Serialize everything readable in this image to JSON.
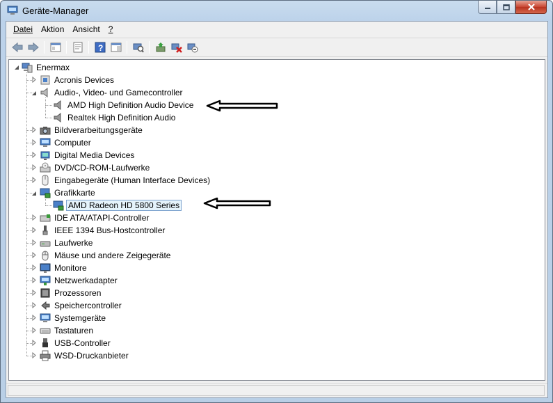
{
  "window": {
    "title": "Geräte-Manager"
  },
  "menu": [
    {
      "label": "Datei"
    },
    {
      "label": "Aktion"
    },
    {
      "label": "Ansicht"
    },
    {
      "label": "?"
    }
  ],
  "toolbar": {
    "buttons": [
      "back-icon",
      "forward-icon",
      "show-hide-console-tree-icon",
      "properties-icon",
      "help-icon",
      "action-pane-icon",
      "scan-hardware-icon",
      "update-driver-icon",
      "uninstall-icon",
      "disable-icon"
    ]
  },
  "tree": {
    "root": "Enermax",
    "categories": [
      {
        "label": "Acronis Devices",
        "icon": "acronis-icon",
        "expanded": false
      },
      {
        "label": "Audio-, Video- und Gamecontroller",
        "icon": "speaker-icon",
        "expanded": true,
        "children": [
          "AMD High Definition Audio Device",
          "Realtek High Definition Audio"
        ]
      },
      {
        "label": "Bildverarbeitungsgeräte",
        "icon": "camera-icon",
        "expanded": false
      },
      {
        "label": "Computer",
        "icon": "computer-icon",
        "expanded": false
      },
      {
        "label": "Digital Media Devices",
        "icon": "media-device-icon",
        "expanded": false
      },
      {
        "label": "DVD/CD-ROM-Laufwerke",
        "icon": "dvd-drive-icon",
        "expanded": false
      },
      {
        "label": "Eingabegeräte (Human Interface Devices)",
        "icon": "hid-icon",
        "expanded": false
      },
      {
        "label": "Grafikkarte",
        "icon": "display-adapter-icon",
        "expanded": true,
        "children": [
          "AMD Radeon HD 5800 Series"
        ]
      },
      {
        "label": "IDE ATA/ATAPI-Controller",
        "icon": "ide-controller-icon",
        "expanded": false
      },
      {
        "label": "IEEE 1394 Bus-Hostcontroller",
        "icon": "firewire-icon",
        "expanded": false
      },
      {
        "label": "Laufwerke",
        "icon": "disk-drive-icon",
        "expanded": false
      },
      {
        "label": "Mäuse und andere Zeigegeräte",
        "icon": "mouse-icon",
        "expanded": false
      },
      {
        "label": "Monitore",
        "icon": "monitor-icon",
        "expanded": false
      },
      {
        "label": "Netzwerkadapter",
        "icon": "network-adapter-icon",
        "expanded": false
      },
      {
        "label": "Prozessoren",
        "icon": "processor-icon",
        "expanded": false
      },
      {
        "label": "Speichercontroller",
        "icon": "storage-controller-icon",
        "expanded": false
      },
      {
        "label": "Systemgeräte",
        "icon": "system-devices-icon",
        "expanded": false
      },
      {
        "label": "Tastaturen",
        "icon": "keyboard-icon",
        "expanded": false
      },
      {
        "label": "USB-Controller",
        "icon": "usb-icon",
        "expanded": false
      },
      {
        "label": "WSD-Druckanbieter",
        "icon": "printer-icon",
        "expanded": false
      }
    ],
    "selected": "AMD Radeon HD 5800 Series"
  },
  "colors": {
    "selection_bg": "#e5f3fb",
    "selection_border": "#7da2ce",
    "title_gradient": "#c9dcee",
    "close_button": "#c84531"
  }
}
